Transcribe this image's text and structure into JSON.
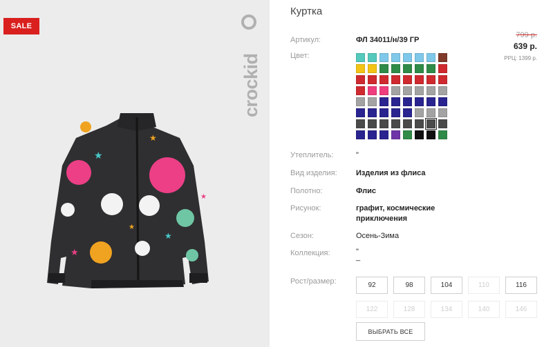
{
  "product": {
    "sale_badge": "SALE",
    "brand": "crockid",
    "title": "Куртка",
    "article_label": "Артикул:",
    "article_value": "ФЛ 34011/н/39 ГР",
    "old_price": "799 р.",
    "new_price": "639 р.",
    "rrp": "РРЦ: 1399 р.",
    "color_label": "Цвет:",
    "colors": [
      "#54c9bc",
      "#54c9bc",
      "#7fc8ea",
      "#7fc8ea",
      "#7fc8ea",
      "#7fc8ea",
      "#7fc8ea",
      "#7f3a2a",
      "#f3c416",
      "#f3c416",
      "#2f8b47",
      "#2f8b47",
      "#2f8b47",
      "#2f8b47",
      "#2f8b47",
      "#cf2a2f",
      "#cf2a2f",
      "#cf2a2f",
      "#cf2a2f",
      "#cf2a2f",
      "#cf2a2f",
      "#cf2a2f",
      "#cf2a2f",
      "#cf2a2f",
      "#cf2a2f",
      "#ef3d7d",
      "#ef3d7d",
      "#a3a3a3",
      "#a3a3a3",
      "#a3a3a3",
      "#a3a3a3",
      "#a3a3a3",
      "#a3a3a3",
      "#a3a3a3",
      "#2a2490",
      "#2a2490",
      "#2a2490",
      "#2a2490",
      "#2a2490",
      "#2a2490",
      "#2a2490",
      "#2a2490",
      "#2a2490",
      "#2a2490",
      "#2a2490",
      "#a3a3a3",
      "#a3a3a3",
      "#a3a3a3",
      "#4a4a4a",
      "#4a4a4a",
      "#4a4a4a",
      "#4a4a4a",
      "#4a4a4a",
      "#4a4a4a",
      "#4a4a4a",
      "#4a4a4a",
      "#2a2490",
      "#2a2490",
      "#2a2490",
      "#6f34a8",
      "#2f8b47",
      "#111111",
      "#111111",
      "#2f8b47"
    ],
    "selected_color_index": 54,
    "insulation_label": "Утеплитель:",
    "insulation_value": "\"",
    "type_label": "Вид изделия:",
    "type_value": "Изделия из флиса",
    "fabric_label": "Полотно:",
    "fabric_value": "Флис",
    "pattern_label": "Рисунок:",
    "pattern_value_line1": "графит, космические",
    "pattern_value_line2": "приключения",
    "season_label": "Сезон:",
    "season_value": "Осень-Зима",
    "collection_label": "Коллекция:",
    "collection_value_line1": "\"",
    "collection_value_line2": "_",
    "size_label": "Рост/размер:",
    "sizes": [
      {
        "label": "92",
        "available": true
      },
      {
        "label": "98",
        "available": true
      },
      {
        "label": "104",
        "available": true
      },
      {
        "label": "110",
        "available": false
      },
      {
        "label": "116",
        "available": true
      },
      {
        "label": "122",
        "available": false
      },
      {
        "label": "128",
        "available": false
      },
      {
        "label": "134",
        "available": false
      },
      {
        "label": "140",
        "available": false
      },
      {
        "label": "146",
        "available": false
      }
    ],
    "select_all_label": "ВЫБРАТЬ ВСЕ"
  }
}
